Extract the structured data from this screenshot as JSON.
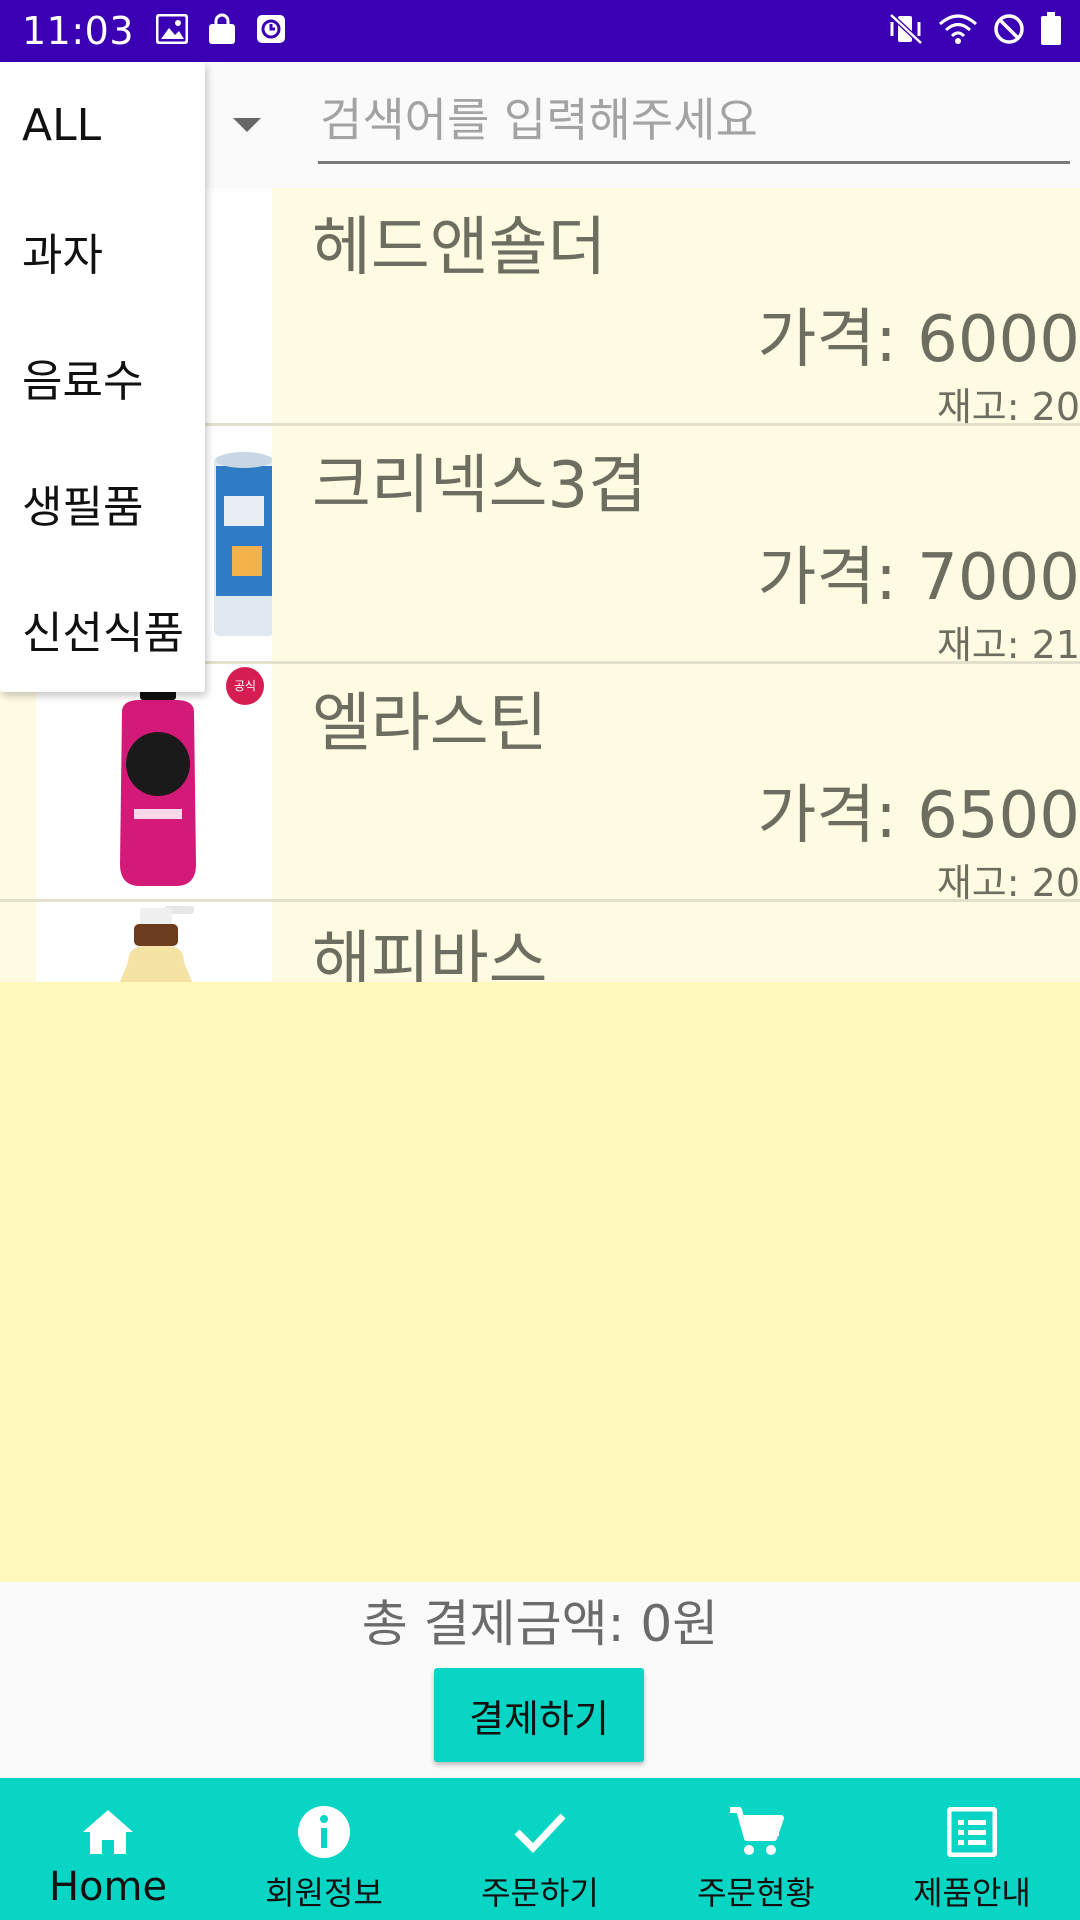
{
  "status_bar": {
    "time": "11:03",
    "left_icons": [
      "image-icon",
      "shopping-bag-icon",
      "clock-app-icon"
    ],
    "right_icons": [
      "vibrate-mute-icon",
      "wifi-icon",
      "do-not-disturb-icon",
      "battery-icon"
    ]
  },
  "search": {
    "placeholder": "검색어를 입력해주세요",
    "value": ""
  },
  "category_dropdown": {
    "options": [
      "ALL",
      "과자",
      "음료수",
      "생필품",
      "신선식품"
    ]
  },
  "products": [
    {
      "name": "헤드앤숄더",
      "price": "가격: 6000",
      "stock": "재고: 20"
    },
    {
      "name": "크리넥스3겹",
      "price": "가격: 7000",
      "stock": "재고: 21"
    },
    {
      "name": "엘라스틴",
      "price": "가격: 6500",
      "stock": "재고: 20",
      "badge": "공식"
    },
    {
      "name": "해피바스",
      "price": "",
      "stock": ""
    }
  ],
  "total": {
    "label": "총 결제금액: 0원"
  },
  "pay_button": {
    "label": "결제하기"
  },
  "bottom_nav": {
    "items": [
      {
        "label": "Home",
        "icon": "home-icon"
      },
      {
        "label": "회원정보",
        "icon": "info-icon"
      },
      {
        "label": "주문하기",
        "icon": "check-icon"
      },
      {
        "label": "주문현황",
        "icon": "cart-icon"
      },
      {
        "label": "제품안내",
        "icon": "list-icon"
      }
    ]
  },
  "colors": {
    "status_bar": "#3c00b4",
    "accent": "#09d5c4",
    "list_bg": "#fffbe3",
    "empty_bg": "#fff8bb"
  }
}
